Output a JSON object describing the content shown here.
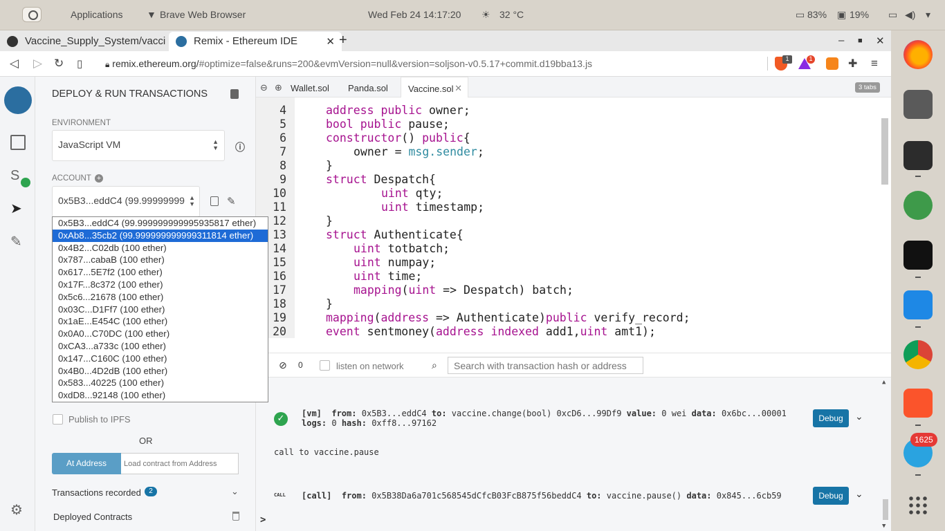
{
  "system_bar": {
    "apps_label": "Applications",
    "browser_label": "Brave Web Browser",
    "datetime": "Wed Feb 24  14:17:20",
    "weather": "32 °C",
    "battery": "83%",
    "memory": "19%"
  },
  "browser": {
    "tabs": [
      {
        "title": "Vaccine_Supply_System/vacci",
        "icon": "github-icon"
      },
      {
        "title": "Remix - Ethereum IDE",
        "icon": "remix-icon"
      }
    ],
    "url_host": "remix.ethereum.org/",
    "url_rest": "#optimize=false&runs=200&evmVersion=null&version=soljson-v0.5.17+commit.d19bba13.js",
    "brave_shield_count": "1",
    "rewards_count": "1"
  },
  "dock": {
    "telegram_badge": "1625"
  },
  "panel": {
    "title": "DEPLOY & RUN TRANSACTIONS",
    "environment_label": "ENVIRONMENT",
    "environment_value": "JavaScript VM",
    "account_label": "ACCOUNT",
    "account_value": "0x5B3...eddC4 (99.99999999",
    "accounts": [
      "0x5B3...eddC4 (99.999999999995935817 ether)",
      "0xAb8...35cb2 (99.999999999999311814 ether)",
      "0x4B2...C02db (100 ether)",
      "0x787...cabaB (100 ether)",
      "0x617...5E7f2 (100 ether)",
      "0x17F...8c372 (100 ether)",
      "0x5c6...21678 (100 ether)",
      "0x03C...D1Ff7 (100 ether)",
      "0x1aE...E454C (100 ether)",
      "0x0A0...C70DC (100 ether)",
      "0xCA3...a733c (100 ether)",
      "0x147...C160C (100 ether)",
      "0x4B0...4D2dB (100 ether)",
      "0x583...40225 (100 ether)",
      "0xdD8...92148 (100 ether)"
    ],
    "selected_account_index": 1,
    "publish_label": "Publish to IPFS",
    "or_label": "OR",
    "at_address_label": "At Address",
    "load_placeholder": "Load contract from Address",
    "transactions_recorded_label": "Transactions recorded",
    "transactions_recorded_count": "2",
    "deployed_contracts_label": "Deployed Contracts"
  },
  "editor": {
    "tabs": [
      "Wallet.sol",
      "Panda.sol",
      "Vaccine.sol"
    ],
    "active_tab": "Vaccine.sol",
    "tabs_count_label": "3 tabs",
    "lines": [
      {
        "n": "4",
        "indent": 1,
        "parts": [
          [
            "k",
            "address"
          ],
          [
            "t",
            " "
          ],
          [
            "k",
            "public"
          ],
          [
            "t",
            " owner;"
          ]
        ]
      },
      {
        "n": "5",
        "indent": 1,
        "parts": [
          [
            "k",
            "bool"
          ],
          [
            "t",
            " "
          ],
          [
            "k",
            "public"
          ],
          [
            "t",
            " pause;"
          ]
        ]
      },
      {
        "n": "6",
        "indent": 1,
        "parts": [
          [
            "k",
            "constructor"
          ],
          [
            "t",
            "() "
          ],
          [
            "k",
            "public"
          ],
          [
            "t",
            "{"
          ]
        ]
      },
      {
        "n": "7",
        "indent": 2,
        "parts": [
          [
            "t",
            "owner = "
          ],
          [
            "b",
            "msg.sender"
          ],
          [
            "t",
            ";"
          ]
        ]
      },
      {
        "n": "8",
        "indent": 1,
        "parts": [
          [
            "t",
            "}"
          ]
        ]
      },
      {
        "n": "9",
        "indent": 1,
        "parts": [
          [
            "k",
            "struct"
          ],
          [
            "t",
            " Despatch{"
          ]
        ]
      },
      {
        "n": "10",
        "indent": 3,
        "parts": [
          [
            "k",
            "uint"
          ],
          [
            "t",
            " qty;"
          ]
        ]
      },
      {
        "n": "11",
        "indent": 3,
        "parts": [
          [
            "k",
            "uint"
          ],
          [
            "t",
            " timestamp;"
          ]
        ]
      },
      {
        "n": "12",
        "indent": 1,
        "parts": [
          [
            "t",
            "}"
          ]
        ]
      },
      {
        "n": "13",
        "indent": 1,
        "parts": [
          [
            "k",
            "struct"
          ],
          [
            "t",
            " Authenticate{"
          ]
        ]
      },
      {
        "n": "14",
        "indent": 2,
        "parts": [
          [
            "k",
            "uint"
          ],
          [
            "t",
            " totbatch;"
          ]
        ]
      },
      {
        "n": "15",
        "indent": 2,
        "parts": [
          [
            "k",
            "uint"
          ],
          [
            "t",
            " numpay;"
          ]
        ]
      },
      {
        "n": "16",
        "indent": 2,
        "parts": [
          [
            "k",
            "uint"
          ],
          [
            "t",
            " time;"
          ]
        ]
      },
      {
        "n": "17",
        "indent": 2,
        "parts": [
          [
            "k",
            "mapping"
          ],
          [
            "t",
            "("
          ],
          [
            "k",
            "uint"
          ],
          [
            "t",
            " => Despatch) batch;"
          ]
        ]
      },
      {
        "n": "18",
        "indent": 1,
        "parts": [
          [
            "t",
            "}"
          ]
        ]
      },
      {
        "n": "19",
        "indent": 1,
        "parts": [
          [
            "k",
            "mapping"
          ],
          [
            "t",
            "("
          ],
          [
            "k",
            "address"
          ],
          [
            "t",
            " => Authenticate)"
          ],
          [
            "k",
            "public"
          ],
          [
            "t",
            " verify_record;"
          ]
        ]
      },
      {
        "n": "20",
        "indent": 1,
        "parts": [
          [
            "k",
            "event"
          ],
          [
            "t",
            " sentmoney("
          ],
          [
            "k",
            "address"
          ],
          [
            "t",
            " "
          ],
          [
            "k",
            "indexed"
          ],
          [
            "t",
            " add1,"
          ],
          [
            "k",
            "uint"
          ],
          [
            "t",
            " amt1);"
          ]
        ]
      }
    ]
  },
  "terminal": {
    "count": "0",
    "listen_label": "listen on network",
    "search_placeholder": "Search with transaction hash or address",
    "tx1_tag": "[vm]",
    "tx1_from_label": "from:",
    "tx1_from": "0x5B3...eddC4",
    "tx1_to_label": "to:",
    "tx1_to": "vaccine.change(bool) 0xcD6...99Df9",
    "tx1_value_label": "value:",
    "tx1_value": "0 wei",
    "tx1_data_label": "data:",
    "tx1_data": "0x6bc...00001",
    "tx1_logs_label": "logs:",
    "tx1_logs": "0",
    "tx1_hash_label": "hash:",
    "tx1_hash": "0xff8...97162",
    "call_text": "call to vaccine.pause",
    "call_icon_label": "CALL",
    "tx2_tag": "[call]",
    "tx2_from_label": "from:",
    "tx2_from": "0x5B38Da6a701c568545dCfcB03FcB875f56beddC4",
    "tx2_to_label": "to:",
    "tx2_to": "vaccine.pause()",
    "tx2_data_label": "data:",
    "tx2_data": "0x845...6cb59",
    "debug_label": "Debug",
    "prompt": ">"
  },
  "colors": {
    "accent": "#1774a6",
    "selection": "#1e6bd6",
    "success": "#2ea44f",
    "keyword": "#a6128f"
  }
}
